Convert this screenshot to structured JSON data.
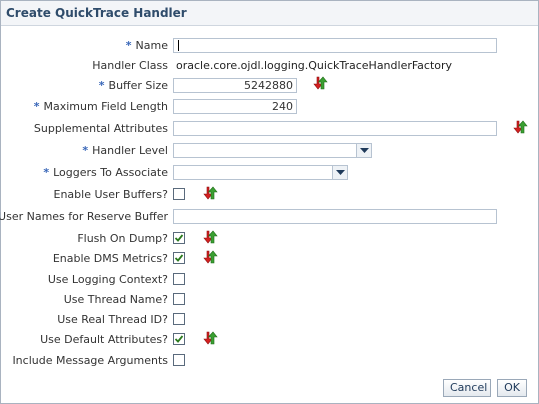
{
  "dialog": {
    "title": "Create QuickTrace Handler",
    "required_marker": "*",
    "fields": {
      "name": {
        "label": "Name",
        "value": ""
      },
      "handler_class": {
        "label": "Handler Class",
        "value": "oracle.core.ojdl.logging.QuickTraceHandlerFactory"
      },
      "buffer_size": {
        "label": "Buffer Size",
        "value": "5242880"
      },
      "max_field_length": {
        "label": "Maximum Field Length",
        "value": "240"
      },
      "supplemental_attributes": {
        "label": "Supplemental Attributes",
        "value": ""
      },
      "handler_level": {
        "label": "Handler Level",
        "value": ""
      },
      "loggers_to_associate": {
        "label": "Loggers To Associate",
        "value": ""
      },
      "enable_user_buffers": {
        "label": "Enable User Buffers?",
        "checked": false
      },
      "user_names_reserve_buffer": {
        "label": "User Names for Reserve Buffer",
        "value": ""
      },
      "flush_on_dump": {
        "label": "Flush On Dump?",
        "checked": true
      },
      "enable_dms_metrics": {
        "label": "Enable DMS Metrics?",
        "checked": true
      },
      "use_logging_context": {
        "label": "Use Logging Context?",
        "checked": false
      },
      "use_thread_name": {
        "label": "Use Thread Name?",
        "checked": false
      },
      "use_real_thread_id": {
        "label": "Use Real Thread ID?",
        "checked": false
      },
      "use_default_attributes": {
        "label": "Use Default Attributes?",
        "checked": true
      },
      "include_message_arguments": {
        "label": "Include Message Arguments",
        "checked": false
      }
    },
    "buttons": {
      "cancel": "Cancel",
      "ok": "OK"
    },
    "icons": {
      "restore_default": "restore-default-icon",
      "dropdown": "chevron-down-icon",
      "check": "check-icon"
    },
    "colors": {
      "required": "#3866b8",
      "title": "#2f4c6b",
      "check": "#2a7a1e"
    }
  }
}
